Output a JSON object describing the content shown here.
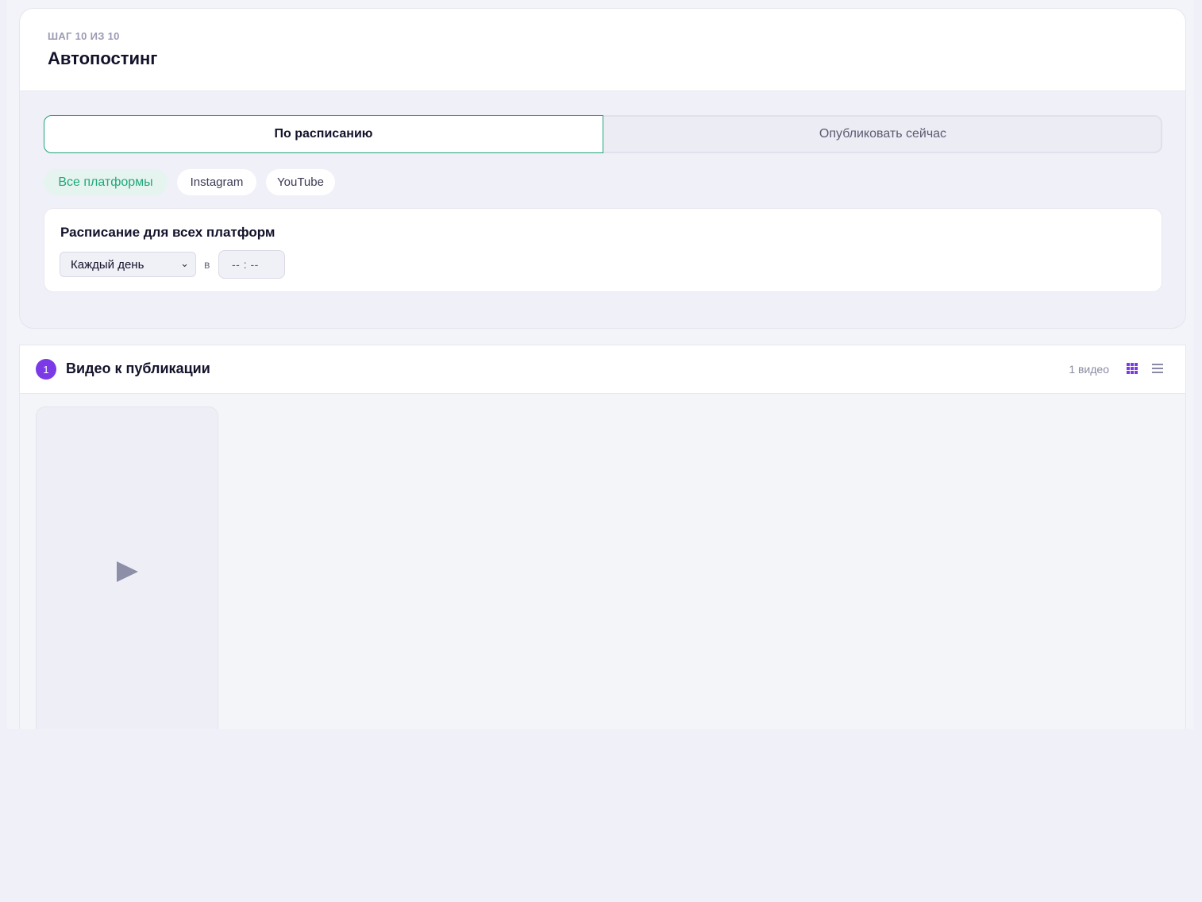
{
  "step": {
    "counter": "ШАГ 10 ИЗ 10",
    "title": "Автопостинг"
  },
  "mode_tabs": [
    {
      "label": "По расписанию",
      "active": true
    },
    {
      "label": "Опубликовать сейчас",
      "active": false
    }
  ],
  "platforms": [
    {
      "label": "Все платформы",
      "selected": true
    },
    {
      "label": "Instagram",
      "selected": false
    },
    {
      "label": "YouTube",
      "selected": false
    }
  ],
  "schedule": {
    "title": "Расписание для всех платформ",
    "frequency_value": "Каждый день",
    "at_label": "в",
    "time_placeholder": "-- : --"
  },
  "videos": {
    "badge": "1",
    "title": "Видео к публикации",
    "count_label": "1 видео",
    "view_icons": [
      "grid-view-icon",
      "list-view-icon"
    ]
  },
  "colors": {
    "accent_green": "#22a37a",
    "accent_purple": "#7b3ae6"
  }
}
